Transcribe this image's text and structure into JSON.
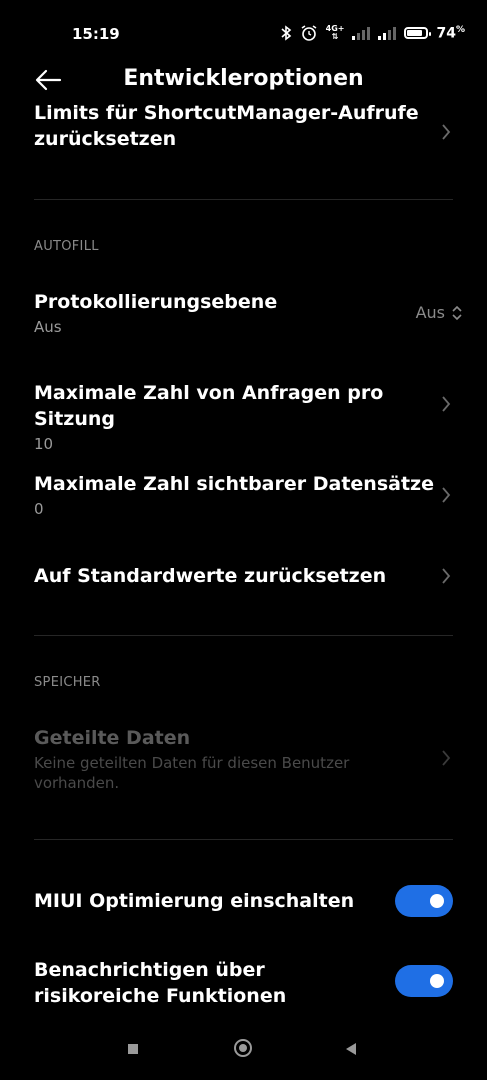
{
  "status": {
    "time": "15:19",
    "network": "4G+",
    "battery_percent": "74",
    "battery_unit": "%"
  },
  "header": {
    "title": "Entwickleroptionen"
  },
  "items": {
    "shortcut_title_l1": "Limits für ShortcutManager-Aufrufe",
    "shortcut_title_l2": "zurücksetzen",
    "autofill_section": "AUTOFILL",
    "protokoll_title": "Protokollierungsebene",
    "protokoll_sub": "Aus",
    "protokoll_value": "Aus",
    "anfragen_title": "Maximale Zahl von Anfragen pro Sitzung",
    "anfragen_sub": "10",
    "datensaetze_title": "Maximale Zahl sichtbarer Datensätze",
    "datensaetze_sub": "0",
    "standard_title": "Auf Standardwerte zurücksetzen",
    "speicher_section": "SPEICHER",
    "geteilte_title": "Geteilte Daten",
    "geteilte_sub": "Keine geteilten Daten für diesen Benutzer vorhanden.",
    "miui_title": "MIUI Optimierung einschalten",
    "risk_title": "Benachrichtigen über risikoreiche Funktionen"
  },
  "toggles": {
    "miui_on": true,
    "risk_on": true,
    "accent_color": "#1f6fe5"
  }
}
